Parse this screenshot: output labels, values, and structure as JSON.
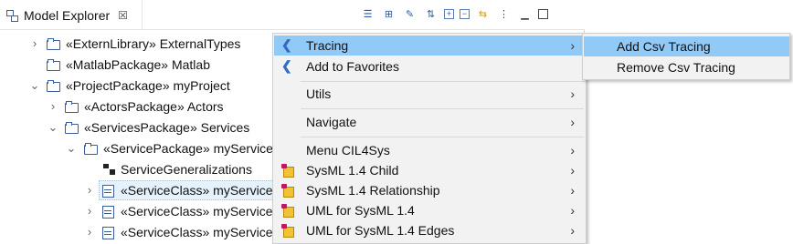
{
  "view": {
    "title": "Model Explorer",
    "close_glyph": "☒",
    "toolbar_icons": [
      "list-icon",
      "tree-icon",
      "edit-icon",
      "sort-az-icon",
      "expand-all-icon",
      "collapse-all-icon",
      "link-icon",
      "view-menu-icon",
      "minimize-icon",
      "maximize-icon"
    ]
  },
  "tree": {
    "rows": [
      {
        "label": "«ExternLibrary» ExternalTypes",
        "icon": "folder",
        "chevron": "right"
      },
      {
        "label": "«MatlabPackage» Matlab",
        "icon": "folder",
        "chevron": ""
      },
      {
        "label": "«ProjectPackage» myProject",
        "icon": "folder",
        "chevron": "down"
      },
      {
        "label": "«ActorsPackage» Actors",
        "icon": "folder",
        "chevron": "right"
      },
      {
        "label": "«ServicesPackage» Services",
        "icon": "folder",
        "chevron": "down"
      },
      {
        "label": "«ServicePackage» myService",
        "icon": "folder",
        "chevron": "down"
      },
      {
        "label": "ServiceGeneralizations",
        "icon": "generalization",
        "chevron": ""
      },
      {
        "label": "«ServiceClass» myService",
        "icon": "class",
        "chevron": "right",
        "selected": true
      },
      {
        "label": "«ServiceClass» myService",
        "icon": "class",
        "chevron": "right"
      },
      {
        "label": "«ServiceClass» myService",
        "icon": "class",
        "chevron": "right"
      }
    ]
  },
  "context_menu": {
    "items": [
      {
        "label": "Tracing",
        "icon": "tracing-icon",
        "submenu": true,
        "highlighted": true
      },
      {
        "label": "Add to Favorites",
        "icon": "tracing-icon",
        "submenu": false
      },
      {
        "label": "Utils",
        "icon": "",
        "submenu": true
      },
      {
        "label": "Navigate",
        "icon": "",
        "submenu": true
      },
      {
        "label": "Menu CIL4Sys",
        "icon": "",
        "submenu": true
      },
      {
        "label": "SysML 1.4 Child",
        "icon": "package-icon",
        "submenu": true
      },
      {
        "label": "SysML 1.4 Relationship",
        "icon": "package-icon",
        "submenu": true
      },
      {
        "label": "UML for SysML 1.4",
        "icon": "package-icon",
        "submenu": true
      },
      {
        "label": "UML for SysML 1.4 Edges",
        "icon": "package-icon",
        "submenu": true
      }
    ],
    "arrow_glyph": "›"
  },
  "submenu": {
    "items": [
      {
        "label": "Add Csv Tracing",
        "highlighted": true
      },
      {
        "label": "Remove Csv Tracing",
        "highlighted": false
      }
    ]
  }
}
